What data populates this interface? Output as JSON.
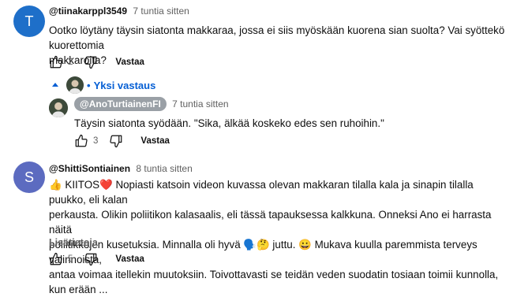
{
  "comments": [
    {
      "avatar_letter": "T",
      "avatar_color": "#1e6fc9",
      "author": "@tiinakarppl3549",
      "time": "7 tuntia sitten",
      "text_lines": [
        "Ootko löytäny täysin siatonta makkaraa, jossa ei siis myöskään kuorena sian suolta? Vai syöttekö kuorettomia",
        "makkaroita?"
      ],
      "likes": "2",
      "reply_label": "Vastaa",
      "replies_toggle": "Yksi vastaus",
      "replies": [
        {
          "author": "@AnoTurtiainenFI",
          "time": "7 tuntia sitten",
          "text": "Täysin siatonta syödään. \"Sika, älkää koskeko edes sen ruhoihin.\"",
          "likes": "3",
          "reply_label": "Vastaa"
        }
      ]
    },
    {
      "avatar_letter": "S",
      "avatar_color": "#5c6bc0",
      "author": "@ShittiSontiainen",
      "time": "8 tuntia sitten",
      "text_lines": [
        "👍 KIITOS❤️ Nopiasti katsoin videon kuvassa olevan makkaran tilalla kala ja sinapin tilalla puukko, eli kalan",
        "perkausta. Olikin poliitikon kalasaalis, eli tässä tapauksessa kalkkuna. Onneksi Ano ei harrasta näitä",
        "poliitikkojen kusetuksia. Minnalla oli hyvä 🗣️🤔 juttu. 😀 Mukava kuulla paremmista terveys valinnoista,",
        "antaa voimaa itellekin muutoksiin. Toivottavasti se teidän veden suodatin tosiaan toimii kunnolla, kun erään ..."
      ],
      "read_more": "Lisätietoja",
      "likes": "5",
      "reply_label": "Vastaa"
    }
  ]
}
